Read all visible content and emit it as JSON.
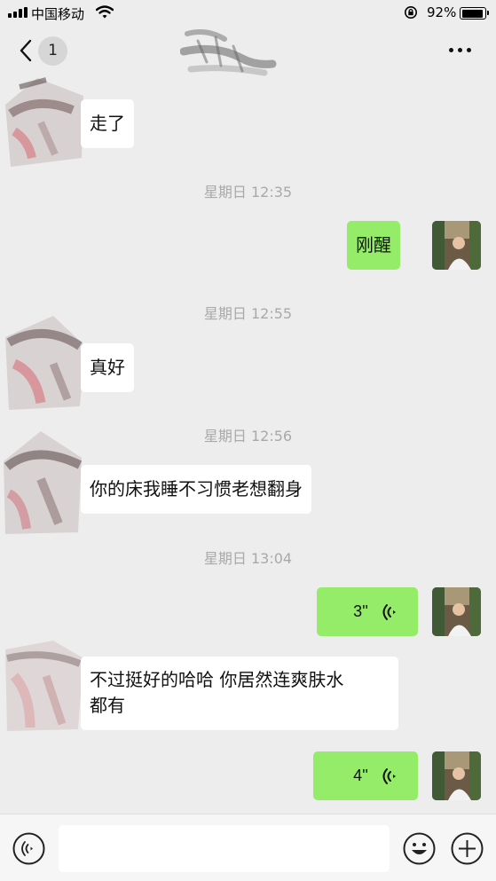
{
  "status_bar": {
    "carrier": "中国移动",
    "battery": "92%"
  },
  "nav": {
    "unread_count": "1"
  },
  "messages": [
    {
      "type": "in",
      "text": "走了"
    },
    {
      "type": "time",
      "text": "星期日 12:35"
    },
    {
      "type": "out",
      "text": "刚醒"
    },
    {
      "type": "time",
      "text": "星期日 12:55"
    },
    {
      "type": "in",
      "text": "真好"
    },
    {
      "type": "time",
      "text": "星期日 12:56"
    },
    {
      "type": "in",
      "text": "你的床我睡不习惯老想翻身"
    },
    {
      "type": "time",
      "text": "星期日 13:04"
    },
    {
      "type": "out-voice",
      "text": "3''"
    },
    {
      "type": "in",
      "text_line1": "不过挺好的哈哈 你居然连爽肤水",
      "text_line2": "都有"
    },
    {
      "type": "out-voice",
      "text": "4''"
    }
  ],
  "input_bar": {
    "placeholder": ""
  },
  "icons": [
    "signal-icon",
    "wifi-icon",
    "orientation-lock-icon",
    "battery-icon",
    "back-icon",
    "more-icon",
    "voice-wave-icon",
    "voice-input-icon",
    "emoji-icon",
    "plus-icon"
  ],
  "colors": {
    "background": "#ededed",
    "outgoing_bubble": "#95ec69",
    "incoming_bubble": "#ffffff",
    "timestamp": "#a9a9a9"
  }
}
